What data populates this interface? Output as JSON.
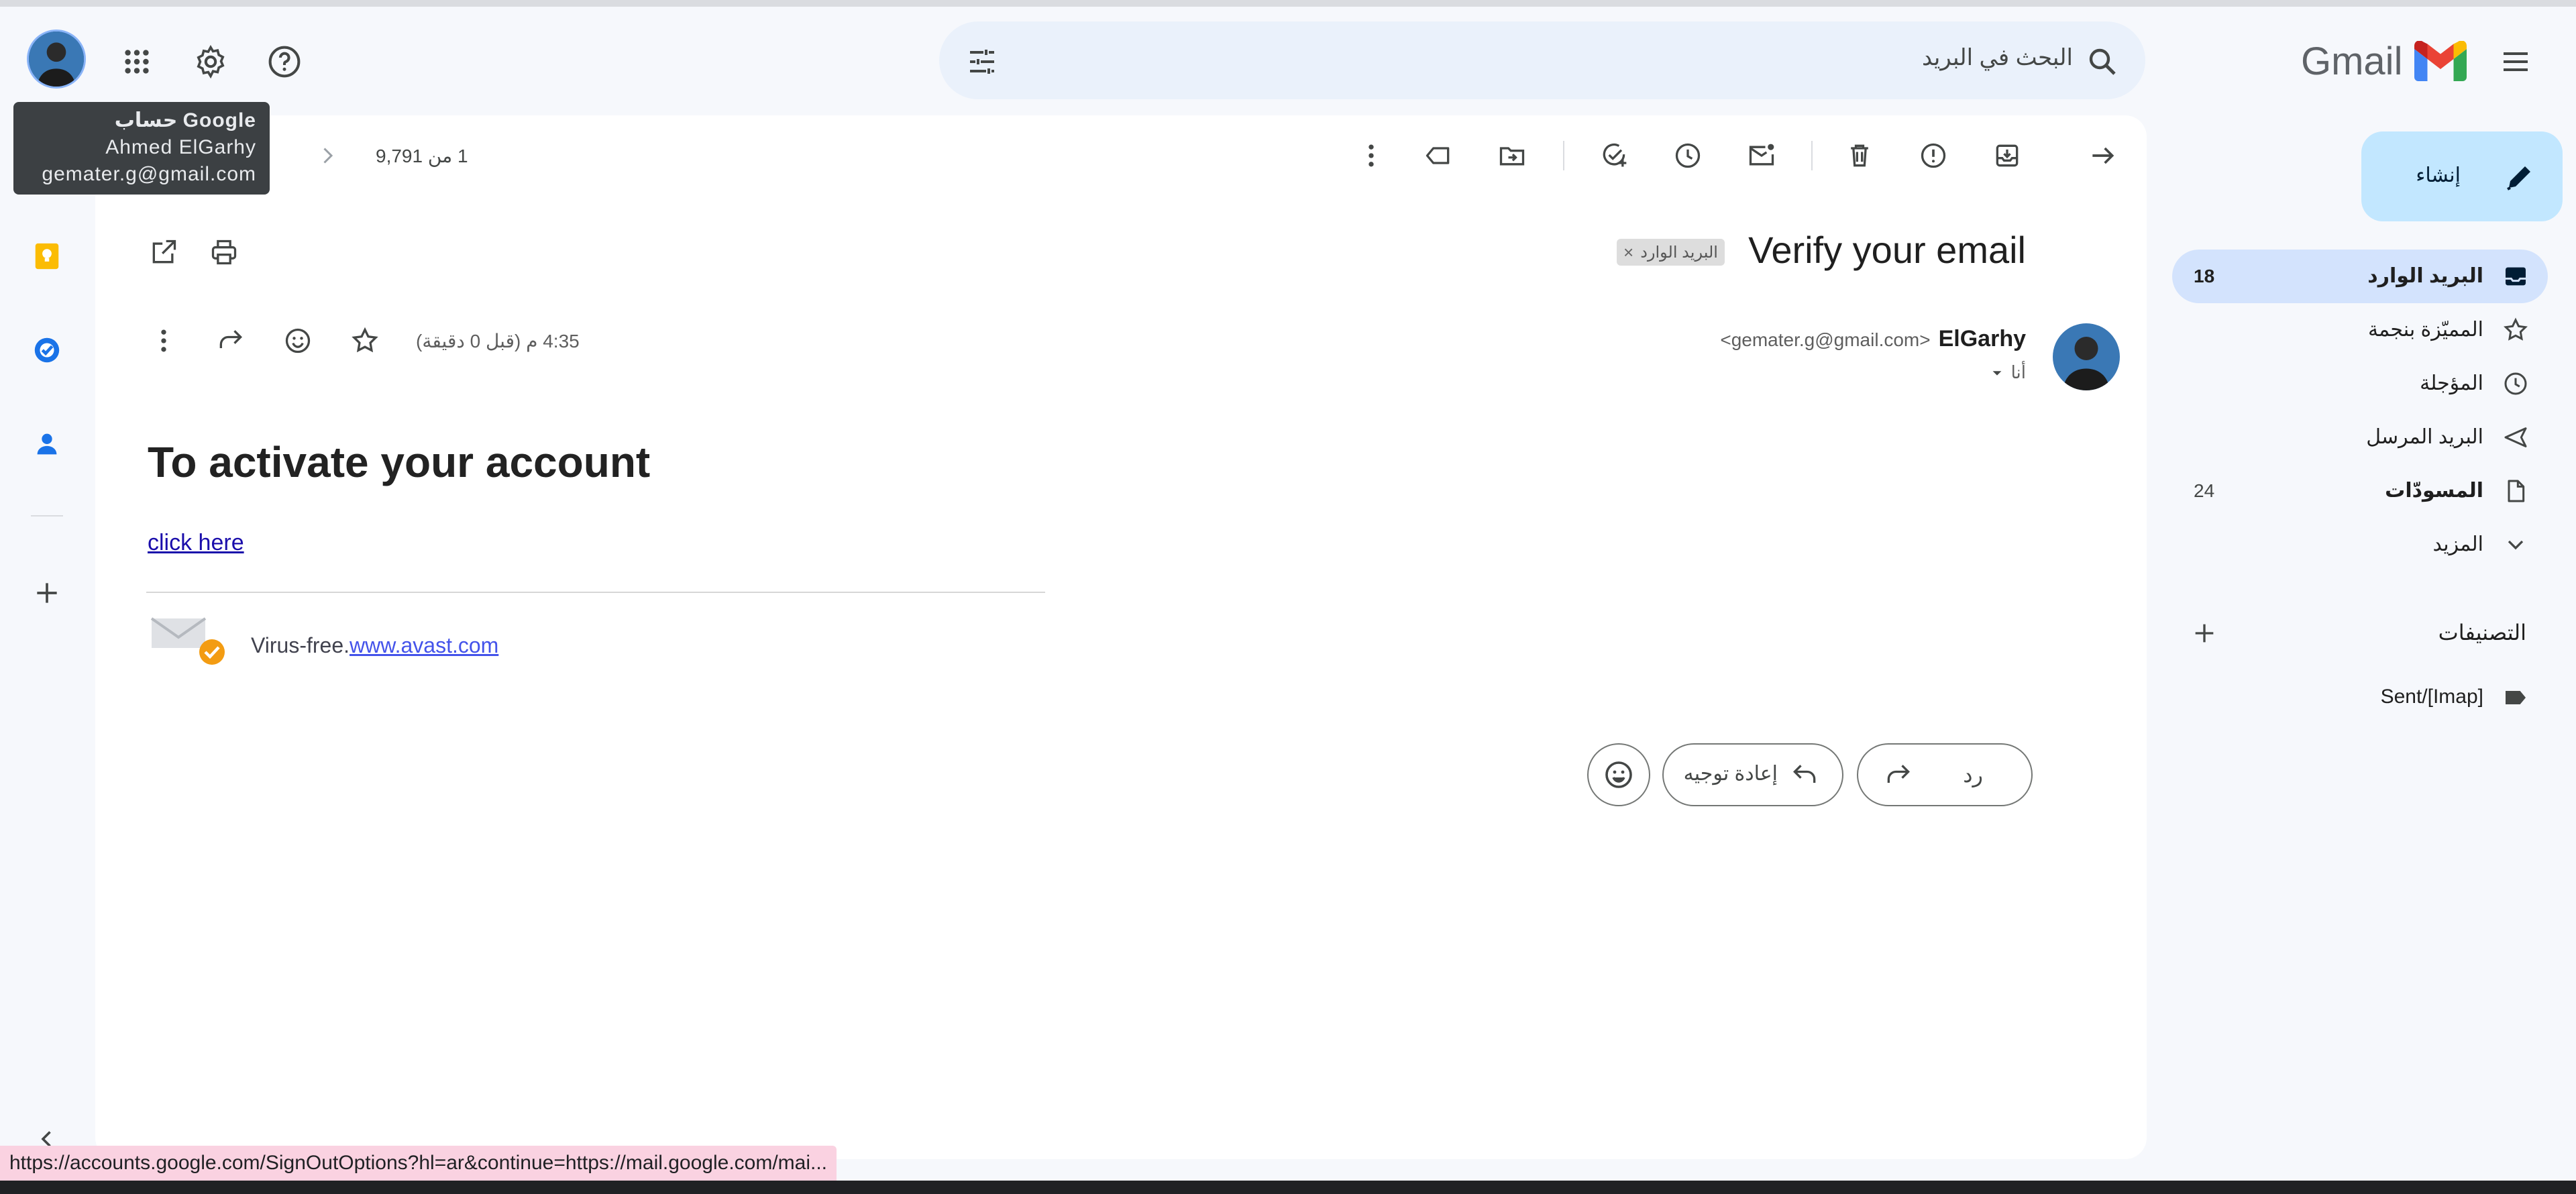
{
  "app": {
    "name": "Gmail"
  },
  "search": {
    "placeholder": "البحث في البريد"
  },
  "sidebar": {
    "compose_label": "إنشاء",
    "items": [
      {
        "label": "البريد الوارد",
        "count": "18"
      },
      {
        "label": "المميّزة بنجمة",
        "count": ""
      },
      {
        "label": "المؤجلة",
        "count": ""
      },
      {
        "label": "البريد المرسل",
        "count": ""
      },
      {
        "label": "المسودّات",
        "count": "24"
      },
      {
        "label": "المزيد",
        "count": ""
      }
    ],
    "labels_heading": "التصنيفات",
    "labels": [
      {
        "name": "Sent/[Imap]"
      }
    ]
  },
  "toolbar": {
    "pagination": "1 من 9,791"
  },
  "message": {
    "subject": "Verify your email",
    "inbox_chip": "البريد الوارد",
    "sender_name": "ElGarhy",
    "sender_email": "<gemater.g@gmail.com>",
    "recipient": "أنا",
    "time": "4:35 م (قبل 0 دقيقة)",
    "heading": "To activate your account",
    "link_text": "click here",
    "virus_free_text": "Virus-free.",
    "avast_link": "www.avast.com",
    "reply_label": "رد",
    "forward_label": "إعادة توجيه"
  },
  "tooltip": {
    "title": "حساب Google",
    "name": "Ahmed ElGarhy",
    "email": "gemater.g@gmail.com"
  },
  "status_bar": {
    "url": "https://accounts.google.com/SignOutOptions?hl=ar&continue=https://mail.google.com/mai..."
  },
  "colors": {
    "accent": "#0b57d0",
    "nav_active": "#d3e3fd",
    "compose": "#c2e7ff",
    "link": "#1a0dab"
  }
}
